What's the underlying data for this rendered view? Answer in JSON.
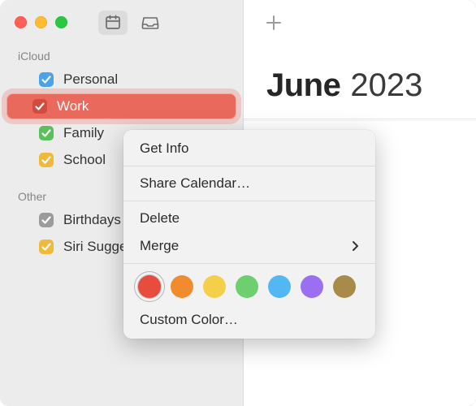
{
  "sidebar": {
    "sections": [
      {
        "name": "iCloud",
        "items": [
          {
            "label": "Personal",
            "color": "#4aa3e8",
            "checked": true
          },
          {
            "label": "Work",
            "color": "#d24b3e",
            "checked": true,
            "selected": true
          },
          {
            "label": "Family",
            "color": "#5ac05a",
            "checked": true
          },
          {
            "label": "School",
            "color": "#f0b93a",
            "checked": true
          }
        ]
      },
      {
        "name": "Other",
        "items": [
          {
            "label": "Birthdays",
            "color": "#9b9b9b",
            "checked": true
          },
          {
            "label": "Siri Suggestions",
            "color": "#f0b93a",
            "checked": true
          }
        ]
      }
    ]
  },
  "header": {
    "month": "June",
    "year": "2023"
  },
  "context_menu": {
    "get_info": "Get Info",
    "share": "Share Calendar…",
    "delete": "Delete",
    "merge": "Merge",
    "custom_color": "Custom Color…",
    "colors": [
      {
        "hex": "#e84c3d",
        "selected": true
      },
      {
        "hex": "#f08c2e",
        "selected": false
      },
      {
        "hex": "#f3cf4a",
        "selected": false
      },
      {
        "hex": "#6dcf6d",
        "selected": false
      },
      {
        "hex": "#53b7f4",
        "selected": false
      },
      {
        "hex": "#9b6ff2",
        "selected": false
      },
      {
        "hex": "#a88a4a",
        "selected": false
      }
    ]
  }
}
